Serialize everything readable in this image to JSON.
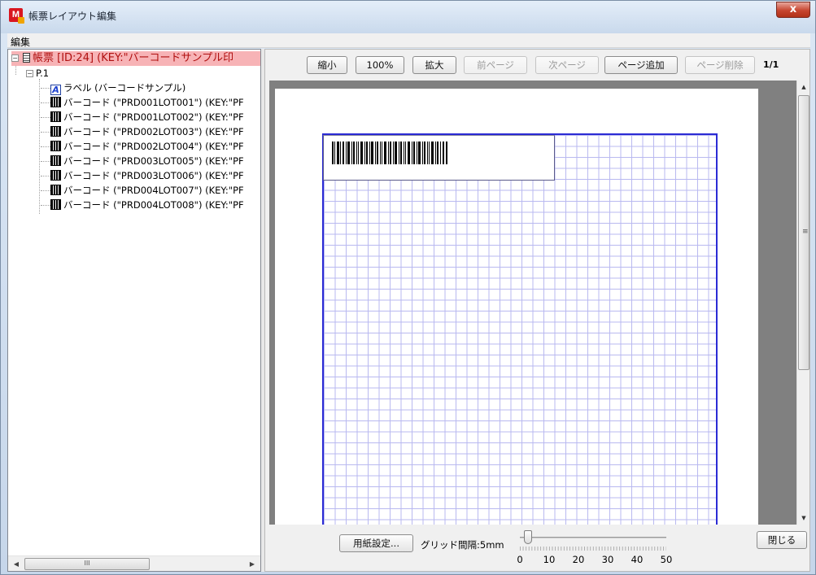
{
  "window": {
    "title": "帳票レイアウト編集",
    "app_icon_letter": "M",
    "close_label": "x"
  },
  "menu": {
    "items": [
      "編集"
    ]
  },
  "tree": {
    "root": {
      "label": "帳票 [ID:24] (KEY:\"バーコードサンプル印",
      "expanded": true,
      "icon": "document-icon"
    },
    "page": {
      "label": "P.1",
      "expanded": true
    },
    "items": [
      {
        "icon": "label-icon",
        "label": "ラベル (バーコードサンプル)"
      },
      {
        "icon": "barcode-icon",
        "label": "バーコード (\"PRD001LOT001\") (KEY:\"PF"
      },
      {
        "icon": "barcode-icon",
        "label": "バーコード (\"PRD001LOT002\") (KEY:\"PF"
      },
      {
        "icon": "barcode-icon",
        "label": "バーコード (\"PRD002LOT003\") (KEY:\"PF"
      },
      {
        "icon": "barcode-icon",
        "label": "バーコード (\"PRD002LOT004\") (KEY:\"PF"
      },
      {
        "icon": "barcode-icon",
        "label": "バーコード (\"PRD003LOT005\") (KEY:\"PF"
      },
      {
        "icon": "barcode-icon",
        "label": "バーコード (\"PRD003LOT006\") (KEY:\"PF"
      },
      {
        "icon": "barcode-icon",
        "label": "バーコード (\"PRD004LOT007\") (KEY:\"PF"
      },
      {
        "icon": "barcode-icon",
        "label": "バーコード (\"PRD004LOT008\") (KEY:\"PF"
      }
    ],
    "hscroll_grip": "III"
  },
  "toolbar": {
    "zoom_out": "縮小",
    "zoom_level": "100%",
    "zoom_in": "拡大",
    "prev_page": "前ページ",
    "next_page": "次ページ",
    "add_page": "ページ追加",
    "delete_page": "ページ削除",
    "page_count": "1/1"
  },
  "canvas": {
    "grid_color": "#b9b9f0",
    "border_color": "#2b2bd4"
  },
  "bottom": {
    "paper_settings": "用紙設定...",
    "grid_spacing_label": "グリッド間隔:5mm",
    "slider": {
      "min": 0,
      "max": 50,
      "value": 5,
      "tick_labels": [
        "0",
        "10",
        "20",
        "30",
        "40",
        "50"
      ]
    },
    "close_button": "閉じる"
  }
}
